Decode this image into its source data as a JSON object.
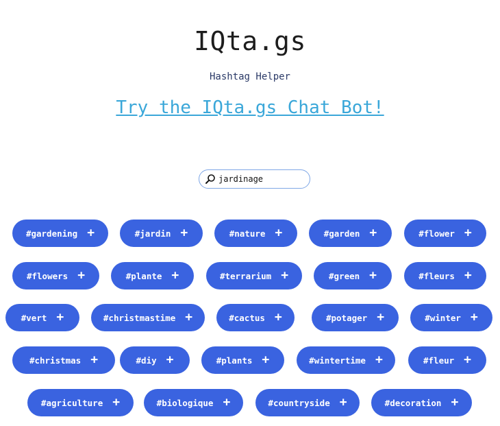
{
  "header": {
    "title": "IQta.gs",
    "subtitle": "Hashtag Helper",
    "chatbot_link": "Try the IQta.gs Chat Bot!"
  },
  "search": {
    "value": "jardinage",
    "icon": "search-icon"
  },
  "tags": [
    "#gardening",
    "#jardin",
    "#nature",
    "#garden",
    "#flower",
    "#flowers",
    "#plante",
    "#terrarium",
    "#green",
    "#fleurs",
    "#vert",
    "#christmastime",
    "#cactus",
    "#potager",
    "#winter",
    "#christmas",
    "#diy",
    "#plants",
    "#wintertime",
    "#fleur",
    "#agriculture",
    "#biologique",
    "#countryside",
    "#decoration"
  ],
  "tag_action_symbol": "+",
  "colors": {
    "tag_bg": "#3a63e0",
    "link": "#3aa7d9",
    "search_border": "#7fa7e6"
  }
}
